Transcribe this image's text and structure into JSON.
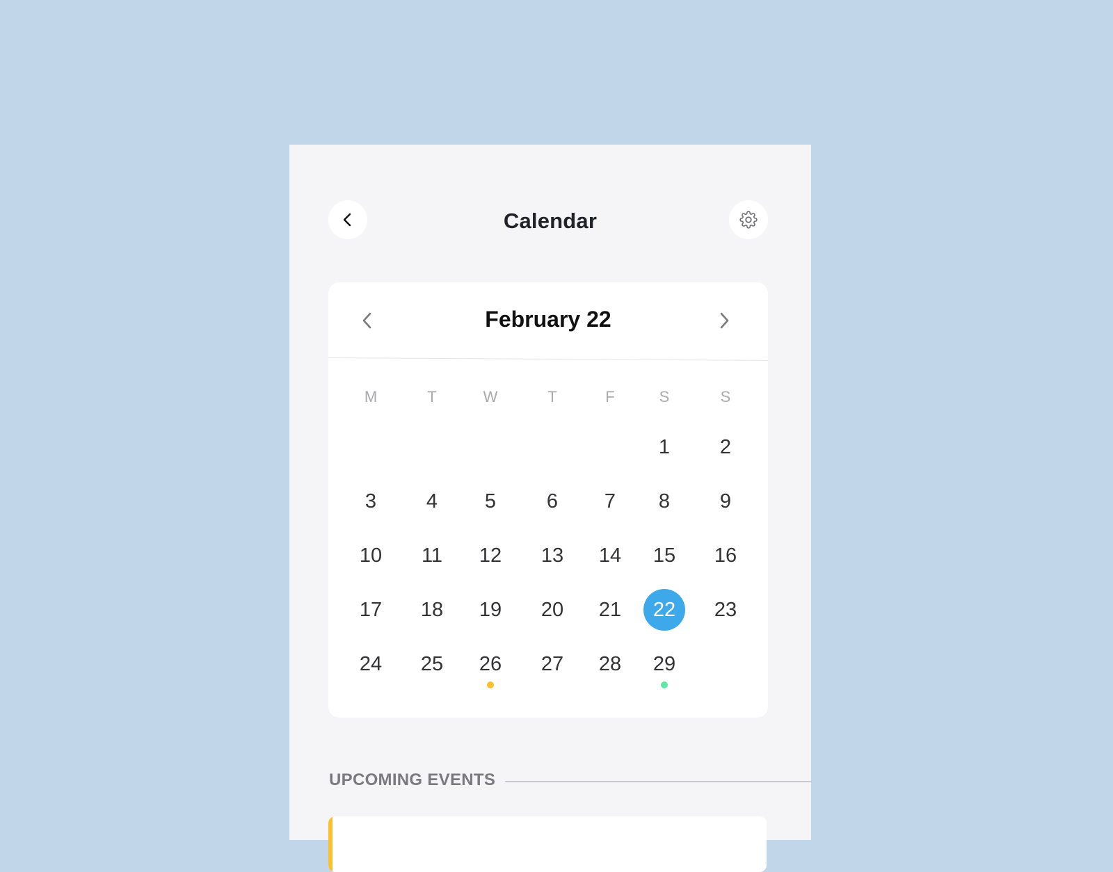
{
  "header": {
    "title": "Calendar",
    "back_icon": "chevron-left-icon",
    "settings_icon": "gear-icon"
  },
  "calendar": {
    "month_label": "February 22",
    "prev_icon": "chevron-left-icon",
    "next_icon": "chevron-right-icon",
    "weekdays": [
      "M",
      "T",
      "W",
      "T",
      "F",
      "S",
      "S"
    ],
    "weeks": [
      [
        "",
        "",
        "",
        "",
        "",
        "1",
        "2"
      ],
      [
        "3",
        "4",
        "5",
        "6",
        "7",
        "8",
        "9"
      ],
      [
        "10",
        "11",
        "12",
        "13",
        "14",
        "15",
        "16"
      ],
      [
        "17",
        "18",
        "19",
        "20",
        "21",
        "22",
        "23"
      ],
      [
        "24",
        "25",
        "26",
        "27",
        "28",
        "29",
        ""
      ]
    ],
    "selected_day": "22",
    "event_markers": [
      {
        "day": "26",
        "color": "#FBC02D"
      },
      {
        "day": "29",
        "color": "#5EE8A6"
      }
    ]
  },
  "colors": {
    "accent": "#3DA9EA",
    "background": "#C1D6E9",
    "panel": "#F5F5F7"
  },
  "upcoming": {
    "title": "UPCOMING EVENTS",
    "events": [
      {
        "accent_color": "#FBC02D"
      }
    ]
  }
}
